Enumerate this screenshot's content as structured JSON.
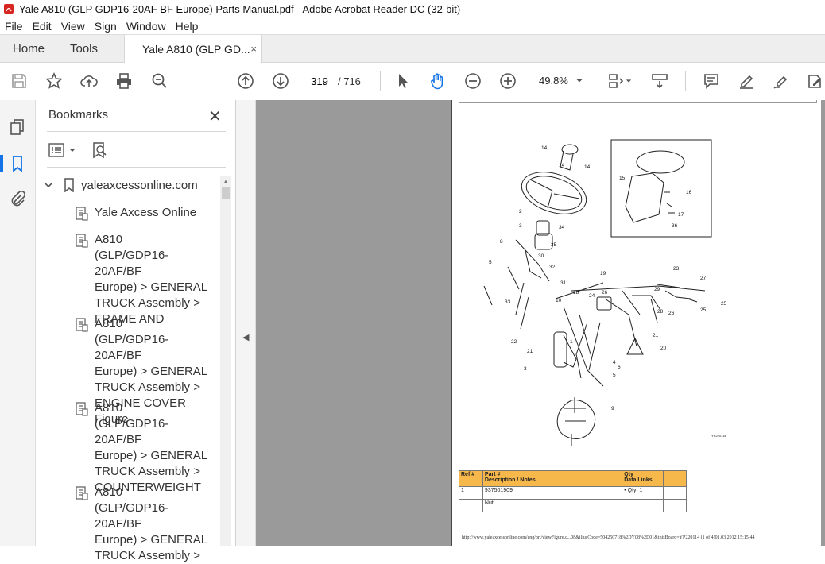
{
  "window": {
    "title": "Yale A810 (GLP GDP16-20AF BF Europe) Parts Manual.pdf - Adobe Acrobat Reader DC (32-bit)"
  },
  "menu": [
    "File",
    "Edit",
    "View",
    "Sign",
    "Window",
    "Help"
  ],
  "tabs": {
    "home": "Home",
    "tools": "Tools",
    "doc": "Yale A810 (GLP GD...",
    "close": "×"
  },
  "toolbar": {
    "page_current": "319",
    "page_total": "/ 716",
    "zoom": "49.8%"
  },
  "bookmarks": {
    "title": "Bookmarks",
    "close": "✕",
    "root": "yaleaxcessonline.com",
    "items": [
      {
        "lines": [
          "Yale Axcess Online"
        ]
      },
      {
        "lines": [
          "A810",
          "(GLP/GDP16-20AF/BF",
          "Europe) > GENERAL",
          "TRUCK Assembly >",
          "FRAME AND"
        ]
      },
      {
        "lines": [
          "A810",
          "(GLP/GDP16-20AF/BF",
          "Europe) > GENERAL",
          "TRUCK Assembly >",
          "ENGINE COVER Figure"
        ]
      },
      {
        "lines": [
          "A810",
          "(GLP/GDP16-20AF/BF",
          "Europe) > GENERAL",
          "TRUCK Assembly >",
          "COUNTERWEIGHT"
        ]
      },
      {
        "lines": [
          "A810",
          "(GLP/GDP16-20AF/BF",
          "Europe) > GENERAL",
          "TRUCK Assembly >"
        ]
      }
    ]
  },
  "document": {
    "figure_id": "YP220114",
    "callouts": [
      "14",
      "14",
      "14",
      "2",
      "34",
      "3",
      "35",
      "5",
      "30",
      "32",
      "31",
      "33",
      "10",
      "18",
      "19",
      "24",
      "26",
      "29",
      "28",
      "23",
      "27",
      "26",
      "25",
      "25",
      "21",
      "20",
      "22",
      "21",
      "3",
      "1",
      "4",
      "6",
      "5",
      "9",
      "15",
      "16",
      "17",
      "36",
      "8"
    ],
    "table": {
      "headers": [
        "Ref #",
        "Part #\nDescription / Notes",
        "Qty\nData Links"
      ],
      "rows": [
        [
          "1",
          "937501909",
          "• Qty: 1"
        ],
        [
          "",
          "Nut",
          ""
        ]
      ]
    },
    "footer": "http://www.yaleaxcessonline.com/eng/prt/viewFigure.c...08&illusCode=504250718%2DY08%2D01&thisBoard=YP220114 (1 of 4)01.03.2012 15:15:44"
  }
}
